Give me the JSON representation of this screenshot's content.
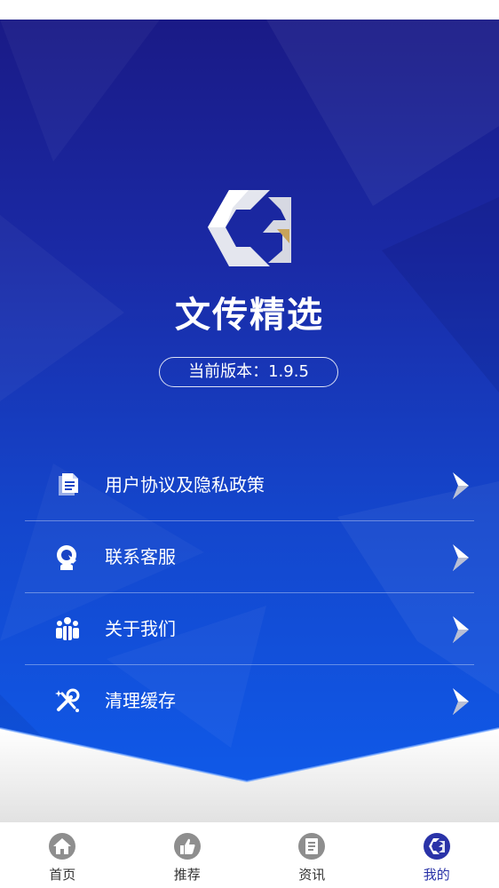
{
  "app": {
    "name": "文传精选",
    "logo_text": "CG",
    "version_label": "当前版本：1.9.5"
  },
  "menu": {
    "items": [
      {
        "label": "用户协议及隐私政策",
        "icon": "document-icon"
      },
      {
        "label": "联系客服",
        "icon": "customer-service-icon"
      },
      {
        "label": "关于我们",
        "icon": "team-icon"
      },
      {
        "label": "清理缓存",
        "icon": "clean-tools-icon"
      }
    ]
  },
  "tabbar": {
    "items": [
      {
        "label": "首页",
        "icon": "home-icon",
        "active": false
      },
      {
        "label": "推荐",
        "icon": "thumbs-up-icon",
        "active": false
      },
      {
        "label": "资讯",
        "icon": "news-icon",
        "active": false
      },
      {
        "label": "我的",
        "icon": "cg-logo-icon",
        "active": true
      }
    ]
  },
  "colors": {
    "hero_top": "#1a1a86",
    "hero_bottom": "#0f5cec",
    "logo_gold": "#c8a45a",
    "active_tab": "#2a33a8"
  }
}
